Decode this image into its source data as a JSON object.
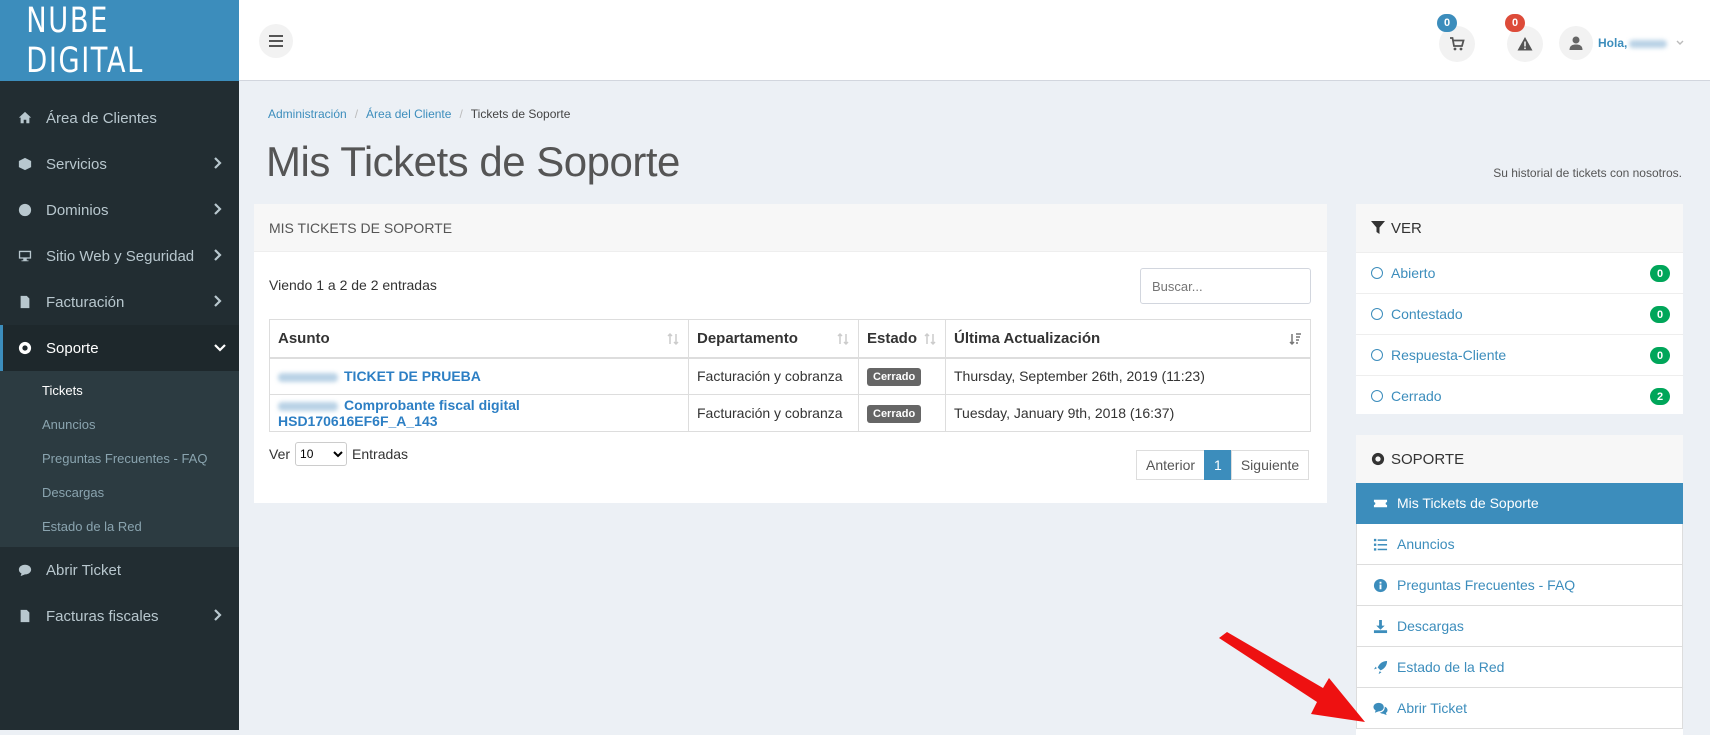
{
  "brand": {
    "logo_text": "NUBE DIGITAL",
    "accent": "#3c8dbc"
  },
  "sidebar": {
    "items": [
      {
        "label": "Área de Clientes",
        "icon": "home-icon"
      },
      {
        "label": "Servicios",
        "icon": "cube-icon"
      },
      {
        "label": "Dominios",
        "icon": "globe-icon"
      },
      {
        "label": "Sitio Web y Seguridad",
        "icon": "desktop-icon"
      },
      {
        "label": "Facturación",
        "icon": "invoice-icon"
      },
      {
        "label": "Soporte",
        "icon": "life-ring-icon"
      },
      {
        "label": "Abrir Ticket",
        "icon": "comment-icon"
      },
      {
        "label": "Facturas fiscales",
        "icon": "invoice-icon"
      }
    ],
    "submenu": [
      "Tickets",
      "Anuncios",
      "Preguntas Frecuentes - FAQ",
      "Descargas",
      "Estado de la Red"
    ]
  },
  "header": {
    "cart_count": "0",
    "alert_count": "0",
    "greeting": "Hola,"
  },
  "breadcrumb": [
    "Administración",
    "Área del Cliente",
    "Tickets de Soporte"
  ],
  "page": {
    "title": "Mis Tickets de Soporte",
    "subtitle": "Su historial de tickets con nosotros."
  },
  "tickets_panel": {
    "heading": "MIS TICKETS DE SOPORTE",
    "showing": "Viendo 1 a 2 de 2 entradas",
    "search_placeholder": "Buscar...",
    "columns": [
      "Asunto",
      "Departamento",
      "Estado",
      "Última Actualización"
    ],
    "rows": [
      {
        "subject": "TICKET DE PRUEBA",
        "department": "Facturación y cobranza",
        "status": "Cerrado",
        "updated": "Thursday, September 26th, 2019 (11:23)"
      },
      {
        "subject": "Comprobante fiscal digital HSD170616EF6F_A_143",
        "department": "Facturación y cobranza",
        "status": "Cerrado",
        "updated": "Tuesday, January 9th, 2018 (16:37)"
      }
    ],
    "ver_label": "Ver",
    "per_page": "10",
    "entries_label": "Entradas",
    "pagination": {
      "prev": "Anterior",
      "current": "1",
      "next": "Siguiente"
    }
  },
  "filter_box": {
    "heading": "VER",
    "items": [
      {
        "label": "Abierto",
        "count": "0"
      },
      {
        "label": "Contestado",
        "count": "0"
      },
      {
        "label": "Respuesta-Cliente",
        "count": "0"
      },
      {
        "label": "Cerrado",
        "count": "2"
      }
    ]
  },
  "support_box": {
    "heading": "SOPORTE",
    "items": [
      {
        "label": "Mis Tickets de Soporte",
        "icon": "ticket-icon"
      },
      {
        "label": "Anuncios",
        "icon": "list-icon"
      },
      {
        "label": "Preguntas Frecuentes - FAQ",
        "icon": "info-icon"
      },
      {
        "label": "Descargas",
        "icon": "download-icon"
      },
      {
        "label": "Estado de la Red",
        "icon": "rocket-icon"
      },
      {
        "label": "Abrir Ticket",
        "icon": "comments-icon"
      }
    ]
  }
}
